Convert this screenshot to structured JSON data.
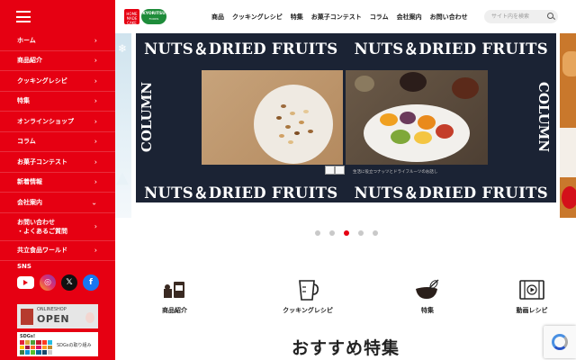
{
  "sidebar": {
    "menu_icon": "hamburger-menu-icon",
    "items": [
      {
        "label": "ホーム"
      },
      {
        "label": "商品紹介"
      },
      {
        "label": "クッキングレシピ"
      },
      {
        "label": "特集"
      },
      {
        "label": "オンラインショップ"
      },
      {
        "label": "コラム"
      },
      {
        "label": "お菓子コンテスト"
      },
      {
        "label": "新着情報"
      },
      {
        "label": "会社案内",
        "expand": "chevron-down"
      },
      {
        "label": "お問い合わせ\n・よくあるご質問"
      },
      {
        "label": "共立食品ワールド"
      }
    ],
    "sns_label": "SNS",
    "sns": [
      "youtube-icon",
      "instagram-icon",
      "x-icon",
      "facebook-icon"
    ],
    "banner_shop_small": "ONLINESHOP",
    "banner_shop_big": "OPEN",
    "banner_sdgs_title": "SDGs!",
    "banner_sdgs_text": "SDGsの取り組み"
  },
  "header": {
    "logo_red_text": "HOME MADE CAKE",
    "logo_green_text": "KYORITSU",
    "logo_green_sub": "FOODS",
    "nav": [
      "商品",
      "クッキングレシピ",
      "特集",
      "お菓子コンテスト",
      "コラム",
      "会社案内",
      "お問い合わせ"
    ],
    "search_placeholder": "サイト内を検索"
  },
  "slide": {
    "headline": "NUTS＆DRIED FRUITS",
    "column_label": "COLUMN",
    "caption": "生活に役立つナッツとドライフルーツのお話し",
    "background": "#1b2334"
  },
  "carousel": {
    "total": 5,
    "active_index": 3
  },
  "categories": [
    {
      "label": "商品紹介",
      "icon": "products-icon"
    },
    {
      "label": "クッキングレシピ",
      "icon": "measuring-cup-icon"
    },
    {
      "label": "特集",
      "icon": "whisk-bowl-icon"
    },
    {
      "label": "動画レシピ",
      "icon": "video-film-icon"
    }
  ],
  "section_heading": "おすすめ特集",
  "colors": {
    "brand_red": "#e60012",
    "brand_green": "#1e8c3a"
  }
}
